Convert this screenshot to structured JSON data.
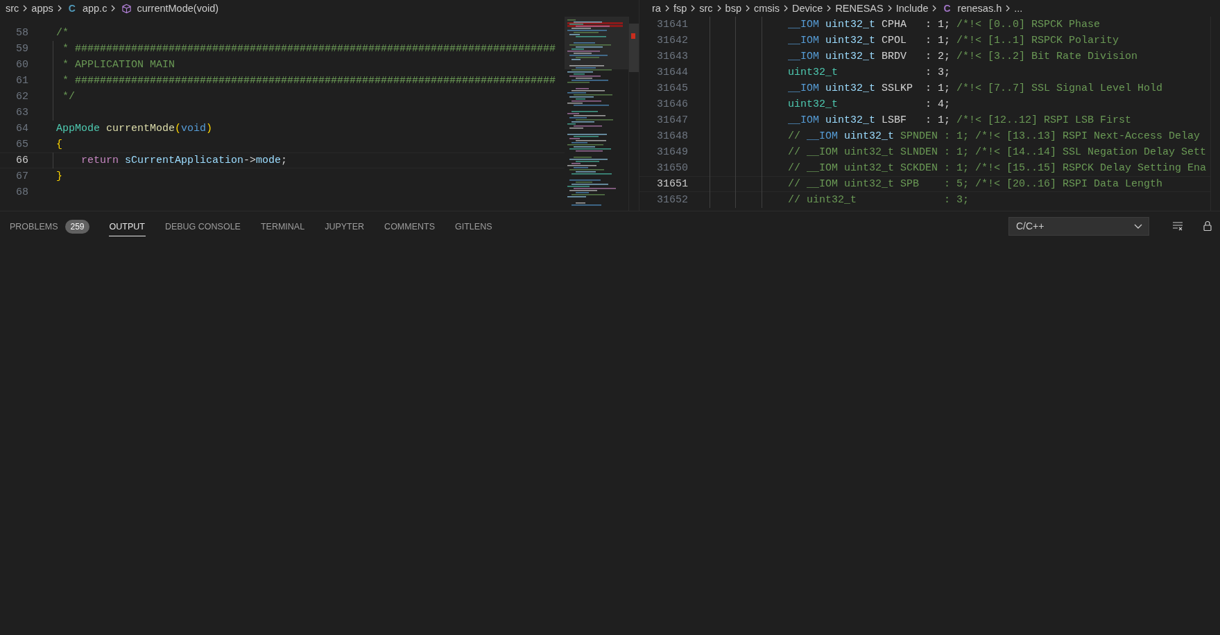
{
  "editors": [
    {
      "breadcrumbs": [
        {
          "label": "src"
        },
        {
          "label": "apps"
        },
        {
          "label": "app.c",
          "icon": "C"
        },
        {
          "label": "currentMode(void)",
          "kind": "symbol"
        }
      ],
      "lines": [
        {
          "number": "58",
          "current": false,
          "indent_guide": false,
          "tokens": [
            {
              "kind": "comment",
              "text": "/*"
            }
          ]
        },
        {
          "number": "59",
          "current": false,
          "indent_guide": true,
          "tokens": [
            {
              "kind": "comment",
              "text": " * #############################################################################"
            }
          ]
        },
        {
          "number": "60",
          "current": false,
          "indent_guide": true,
          "tokens": [
            {
              "kind": "comment",
              "text": " * APPLICATION MAIN"
            }
          ]
        },
        {
          "number": "61",
          "current": false,
          "indent_guide": true,
          "tokens": [
            {
              "kind": "comment",
              "text": " * #############################################################################"
            }
          ]
        },
        {
          "number": "62",
          "current": false,
          "indent_guide": true,
          "tokens": [
            {
              "kind": "comment",
              "text": " */"
            }
          ]
        },
        {
          "number": "63",
          "current": false,
          "indent_guide": true
        },
        {
          "number": "64",
          "current": false,
          "indent_guide": false,
          "tokens": [
            {
              "kind": "type",
              "text": "AppMode"
            },
            {
              "kind": "func",
              "text": " currentMode"
            },
            {
              "kind": "bracket",
              "text": "("
            },
            {
              "kind": "keyword",
              "text": "void"
            },
            {
              "kind": "bracket",
              "text": ")"
            }
          ]
        },
        {
          "number": "65",
          "current": false,
          "indent_guide": false,
          "tokens": [
            {
              "kind": "bracket",
              "text": "{"
            }
          ]
        },
        {
          "number": "66",
          "current": true,
          "indent_guide": true,
          "tokens": [
            {
              "kind": "control",
              "text": "    return"
            },
            {
              "kind": "variable",
              "text": " sCurrentApplication"
            },
            {
              "kind": "plain",
              "text": "->"
            },
            {
              "kind": "variable",
              "text": "mode"
            },
            {
              "kind": "plain",
              "text": ";"
            }
          ]
        },
        {
          "number": "67",
          "current": false,
          "indent_guide": false,
          "tokens": [
            {
              "kind": "bracket",
              "text": "}"
            }
          ]
        },
        {
          "number": "68",
          "current": false,
          "indent_guide": false
        }
      ]
    },
    {
      "breadcrumbs": [
        {
          "label": "ra"
        },
        {
          "label": "fsp"
        },
        {
          "label": "src"
        },
        {
          "label": "bsp"
        },
        {
          "label": "cmsis"
        },
        {
          "label": "Device"
        },
        {
          "label": "RENESAS"
        },
        {
          "label": "Include"
        },
        {
          "label": "renesas.h",
          "icon": "C"
        },
        {
          "label": "..."
        }
      ],
      "lines": [
        {
          "number": "31641",
          "current": false,
          "indent_guide": true,
          "tokens": [
            {
              "kind": "macro",
              "text": "__IOM"
            },
            {
              "kind": "field",
              "text": " uint32_t"
            },
            {
              "kind": "plain",
              "text": " CPHA   : 1;"
            },
            {
              "kind": "comment",
              "text": " /*!< [0..0] RSPCK Phase"
            }
          ]
        },
        {
          "number": "31642",
          "current": false,
          "indent_guide": true,
          "tokens": [
            {
              "kind": "macro",
              "text": "__IOM"
            },
            {
              "kind": "field",
              "text": " uint32_t"
            },
            {
              "kind": "plain",
              "text": " CPOL   : 1;"
            },
            {
              "kind": "comment",
              "text": " /*!< [1..1] RSPCK Polarity"
            }
          ]
        },
        {
          "number": "31643",
          "current": false,
          "indent_guide": true,
          "tokens": [
            {
              "kind": "macro",
              "text": "__IOM"
            },
            {
              "kind": "field",
              "text": " uint32_t"
            },
            {
              "kind": "plain",
              "text": " BRDV   : 2;"
            },
            {
              "kind": "comment",
              "text": " /*!< [3..2] Bit Rate Division"
            }
          ]
        },
        {
          "number": "31644",
          "current": false,
          "indent_guide": true,
          "tokens": [
            {
              "kind": "type",
              "text": "uint32_t"
            },
            {
              "kind": "plain",
              "text": "              : 3;"
            }
          ]
        },
        {
          "number": "31645",
          "current": false,
          "indent_guide": true,
          "tokens": [
            {
              "kind": "macro",
              "text": "__IOM"
            },
            {
              "kind": "field",
              "text": " uint32_t"
            },
            {
              "kind": "plain",
              "text": " SSLKP  : 1;"
            },
            {
              "kind": "comment",
              "text": " /*!< [7..7] SSL Signal Level Hold"
            }
          ]
        },
        {
          "number": "31646",
          "current": false,
          "indent_guide": true,
          "tokens": [
            {
              "kind": "type",
              "text": "uint32_t"
            },
            {
              "kind": "plain",
              "text": "              : 4;"
            }
          ]
        },
        {
          "number": "31647",
          "current": false,
          "indent_guide": true,
          "tokens": [
            {
              "kind": "macro",
              "text": "__IOM"
            },
            {
              "kind": "field",
              "text": " uint32_t"
            },
            {
              "kind": "plain",
              "text": " LSBF   : 1;"
            },
            {
              "kind": "comment",
              "text": " /*!< [12..12] RSPI LSB First"
            }
          ]
        },
        {
          "number": "31648",
          "current": false,
          "indent_guide": true,
          "tokens": [
            {
              "kind": "comment",
              "text": "//"
            },
            {
              "kind": "macro",
              "text": " __IOM"
            },
            {
              "kind": "field",
              "text": " uint32_t"
            },
            {
              "kind": "comment",
              "text": " SPNDEN : 1; /*!< [13..13] RSPI Next-Access Delay"
            }
          ]
        },
        {
          "number": "31649",
          "current": false,
          "indent_guide": true,
          "tokens": [
            {
              "kind": "comment",
              "text": "// __IOM uint32_t SLNDEN : 1; /*!< [14..14] SSL Negation Delay Sett"
            }
          ]
        },
        {
          "number": "31650",
          "current": false,
          "indent_guide": true,
          "tokens": [
            {
              "kind": "comment",
              "text": "// __IOM uint32_t SCKDEN : 1; /*!< [15..15] RSPCK Delay Setting Ena"
            }
          ]
        },
        {
          "number": "31651",
          "current": true,
          "indent_guide": true,
          "tokens": [
            {
              "kind": "comment",
              "text": "// __IOM uint32_t SPB    : 5; /*!< [20..16] RSPI Data Length"
            }
          ]
        },
        {
          "number": "31652",
          "current": false,
          "indent_guide": true,
          "tokens": [
            {
              "kind": "comment",
              "text": "// uint32_t              : 3;"
            }
          ]
        }
      ]
    }
  ],
  "panel": {
    "tabs": [
      {
        "label": "PROBLEMS",
        "badge": "259",
        "selected": false
      },
      {
        "label": "OUTPUT",
        "selected": true
      },
      {
        "label": "DEBUG CONSOLE",
        "selected": false
      },
      {
        "label": "TERMINAL",
        "selected": false
      },
      {
        "label": "JUPYTER",
        "selected": false
      },
      {
        "label": "COMMENTS",
        "selected": false
      },
      {
        "label": "GITLENS",
        "selected": false
      }
    ],
    "output_channel": "C/C++"
  }
}
